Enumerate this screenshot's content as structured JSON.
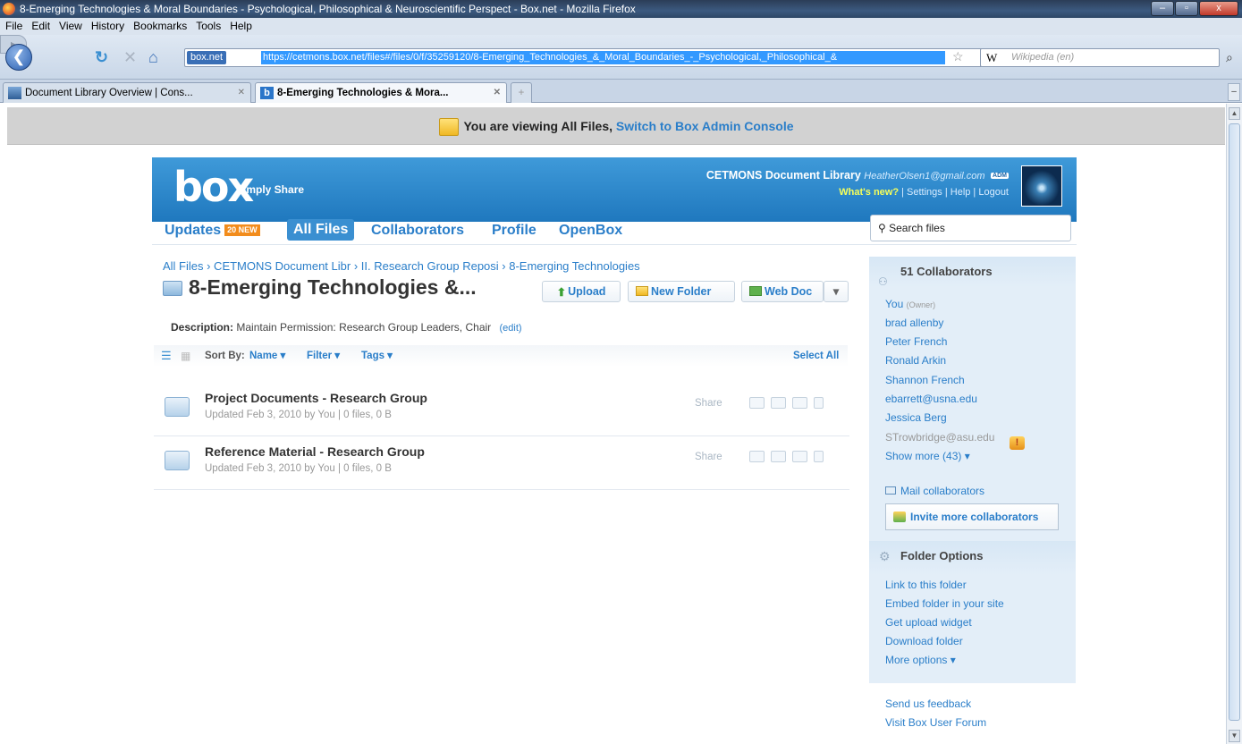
{
  "window": {
    "title": "8-Emerging Technologies & Moral Boundaries - Psychological, Philosophical & Neuroscientific Perspect - Box.net - Mozilla Firefox",
    "controls": [
      "–",
      "▫",
      "x"
    ]
  },
  "menu": [
    "File",
    "Edit",
    "View",
    "History",
    "Bookmarks",
    "Tools",
    "Help"
  ],
  "toolbar": {
    "site_badge": "box.net",
    "url": "https://cetmons.box.net/files#/files/0/f/35259120/8-Emerging_Technologies_&_Moral_Boundaries_-_Psychological,_Philosophical_&",
    "search_engine": "W",
    "search_placeholder": "Wikipedia (en)"
  },
  "tabs": [
    {
      "label": "Document Library Overview | Cons...",
      "active": false
    },
    {
      "label": "8-Emerging Technologies & Mora...",
      "active": true
    }
  ],
  "notice": {
    "text": "You are viewing All Files,",
    "link": "Switch to Box Admin Console"
  },
  "box": {
    "logo": "box",
    "tagline": "Simply Share",
    "library": "CETMONS Document Library",
    "email": "HeatherOlsen1@gmail.com",
    "email_badge": "ADM",
    "whats_new": "What's new?",
    "links": "| Settings | Help | Logout"
  },
  "nav": {
    "updates": "Updates",
    "updates_badge": "20 NEW",
    "all_files": "All Files",
    "collaborators": "Collaborators",
    "profile": "Profile",
    "openbox": "OpenBox",
    "search": "Search files"
  },
  "breadcrumb": "All Files › CETMONS Document Libr › II. Research Group Reposi › 8-Emerging Technologies",
  "folder_title": "8-Emerging Technologies &...",
  "buttons": {
    "upload": "Upload",
    "new_folder": "New Folder",
    "web_doc": "Web Doc",
    "dropdown": "▾"
  },
  "description": {
    "label": "Description:",
    "text": "Maintain Permission: Research Group Leaders, Chair",
    "edit": "(edit)"
  },
  "sort": {
    "label": "Sort By:",
    "name": "Name ▾",
    "filter": "Filter ▾",
    "tags": "Tags ▾",
    "select_all": "Select All"
  },
  "files": [
    {
      "name": "Project Documents - Research Group",
      "meta": "Updated Feb 3, 2010 by You | 0 files, 0 B",
      "share": "Share"
    },
    {
      "name": "Reference Material - Research Group",
      "meta": "Updated Feb 3, 2010 by You | 0 files, 0 B",
      "share": "Share"
    }
  ],
  "sidebar": {
    "collab_title": "51 Collaborators",
    "collaborators": [
      {
        "name": "You",
        "note": "(Owner)"
      },
      {
        "name": "brad allenby"
      },
      {
        "name": "Peter French"
      },
      {
        "name": "Ronald Arkin"
      },
      {
        "name": "Shannon French"
      },
      {
        "name": "ebarrett@usna.edu"
      },
      {
        "name": "Jessica Berg"
      },
      {
        "name": "STrowbridge@asu.edu"
      },
      {
        "name": "Show more (43) ▾"
      }
    ],
    "mail": "Mail collaborators",
    "invite": "Invite more collaborators",
    "options_title": "Folder Options",
    "options": [
      "Link to this folder",
      "Embed folder in your site",
      "Get upload widget",
      "Download folder",
      "More options ▾"
    ]
  },
  "footer": [
    "Send us feedback",
    "Visit Box User Forum"
  ],
  "colors": {
    "box_blue": "#2a7ec9",
    "header_blue": "#3f9ad9",
    "badge_orange": "#f28c1c"
  }
}
